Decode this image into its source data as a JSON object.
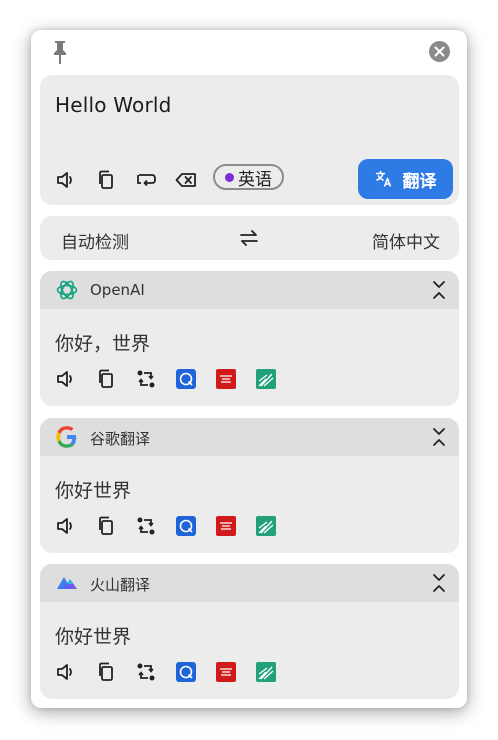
{
  "input": {
    "text": "Hello World",
    "detected_language": "英语",
    "translate_label": "翻译"
  },
  "language_bar": {
    "source": "自动检测",
    "target": "简体中文"
  },
  "results": [
    {
      "service": "OpenAI",
      "text": "你好，世界"
    },
    {
      "service": "谷歌翻译",
      "text": "你好世界"
    },
    {
      "service": "火山翻译",
      "text": "你好世界"
    }
  ],
  "colors": {
    "accent": "#2f7be5",
    "badge_dot": "#7a2fd6",
    "card_bg": "#ececec",
    "header_bg": "#dedede"
  }
}
